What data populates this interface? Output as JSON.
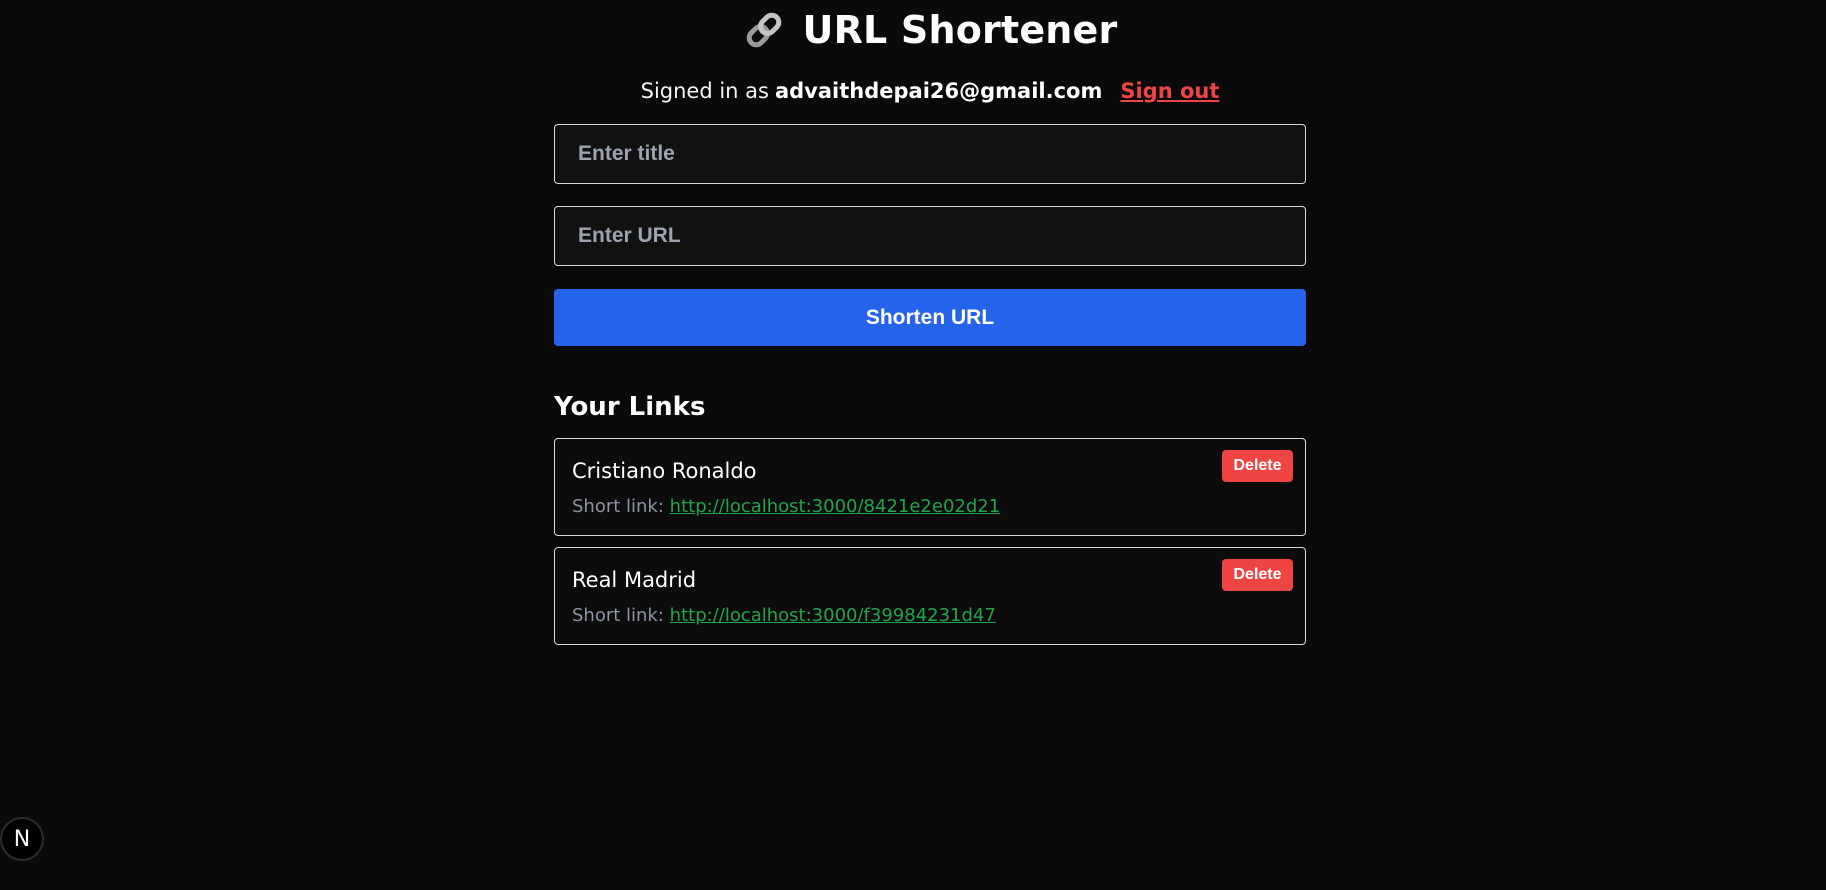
{
  "header": {
    "icon": "link-icon",
    "title": "URL Shortener"
  },
  "auth": {
    "prefix": "Signed in as",
    "email": "advaithdepai26@gmail.com",
    "sign_out": "Sign out"
  },
  "form": {
    "title_placeholder": "Enter title",
    "title_value": "",
    "url_placeholder": "Enter URL",
    "url_value": "",
    "submit_label": "Shorten URL"
  },
  "links_section": {
    "heading": "Your Links",
    "short_link_label": "Short link:",
    "delete_label": "Delete",
    "items": [
      {
        "title": "Cristiano Ronaldo",
        "short_url": "http://localhost:3000/8421e2e02d21"
      },
      {
        "title": "Real Madrid",
        "short_url": "http://localhost:3000/f39984231d47"
      }
    ]
  },
  "badge": {
    "letter": "N",
    "icon": "nextjs-icon"
  },
  "colors": {
    "background": "#0a0a0a",
    "primary": "#2563eb",
    "danger": "#ef4444",
    "link": "#22a44a"
  }
}
